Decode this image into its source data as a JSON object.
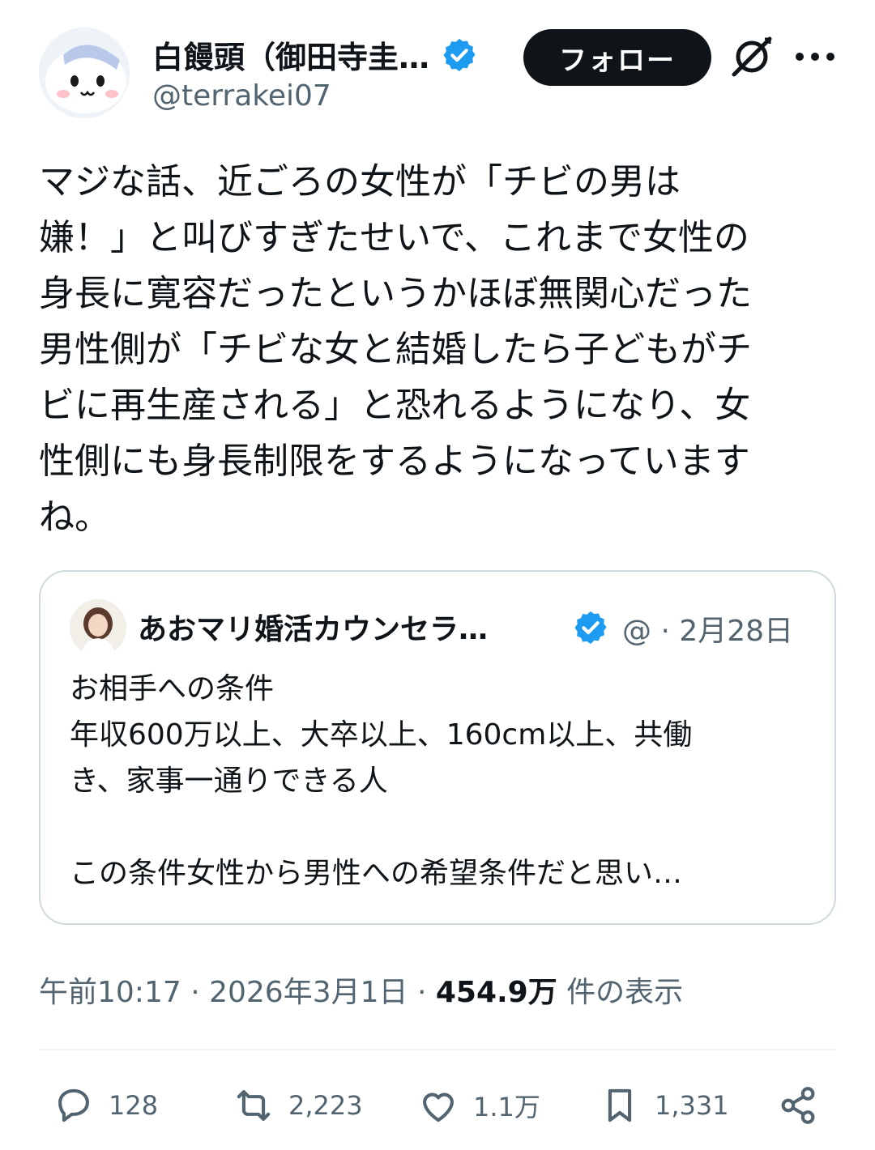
{
  "author": {
    "name": "白饅頭（御田寺圭…",
    "handle": "@terrakei07"
  },
  "header": {
    "follow_label": "フォロー"
  },
  "tweet": {
    "text": "マジな話、近ごろの女性が「チビの男は\n嫌！」と叫びすぎたせいで、これまで女性の\n身長に寛容だったというかほぼ無関心だった\n男性側が「チビな女と結婚したら子どもがチ\nビに再生産される」と恐れるようになり、女\n性側にも身長制限をするようになっています\nね。"
  },
  "quote": {
    "name": "あおマリ婚活カウンセラ…",
    "meta": "@ · 2月28日",
    "text": "お相手への条件\n年収600万以上、大卒以上、160cm以上、共働\nき、家事一通りできる人\n\nこの条件女性から男性への希望条件だと思い…"
  },
  "meta": {
    "time_date": "午前10:17 · 2026年3月1日 · ",
    "views_count": "454.9万",
    "views_label": " 件の表示"
  },
  "actions": {
    "replies": "128",
    "retweets": "2,223",
    "likes": "1.1万",
    "bookmarks": "1,331"
  },
  "colors": {
    "text": "#0f1419",
    "secondary": "#536471",
    "verified": "#1d9bf0",
    "border": "#cfd9de"
  },
  "icons": [
    "grok-icon",
    "more-icon",
    "verified-icon",
    "reply-icon",
    "retweet-icon",
    "like-icon",
    "bookmark-icon",
    "share-icon"
  ]
}
